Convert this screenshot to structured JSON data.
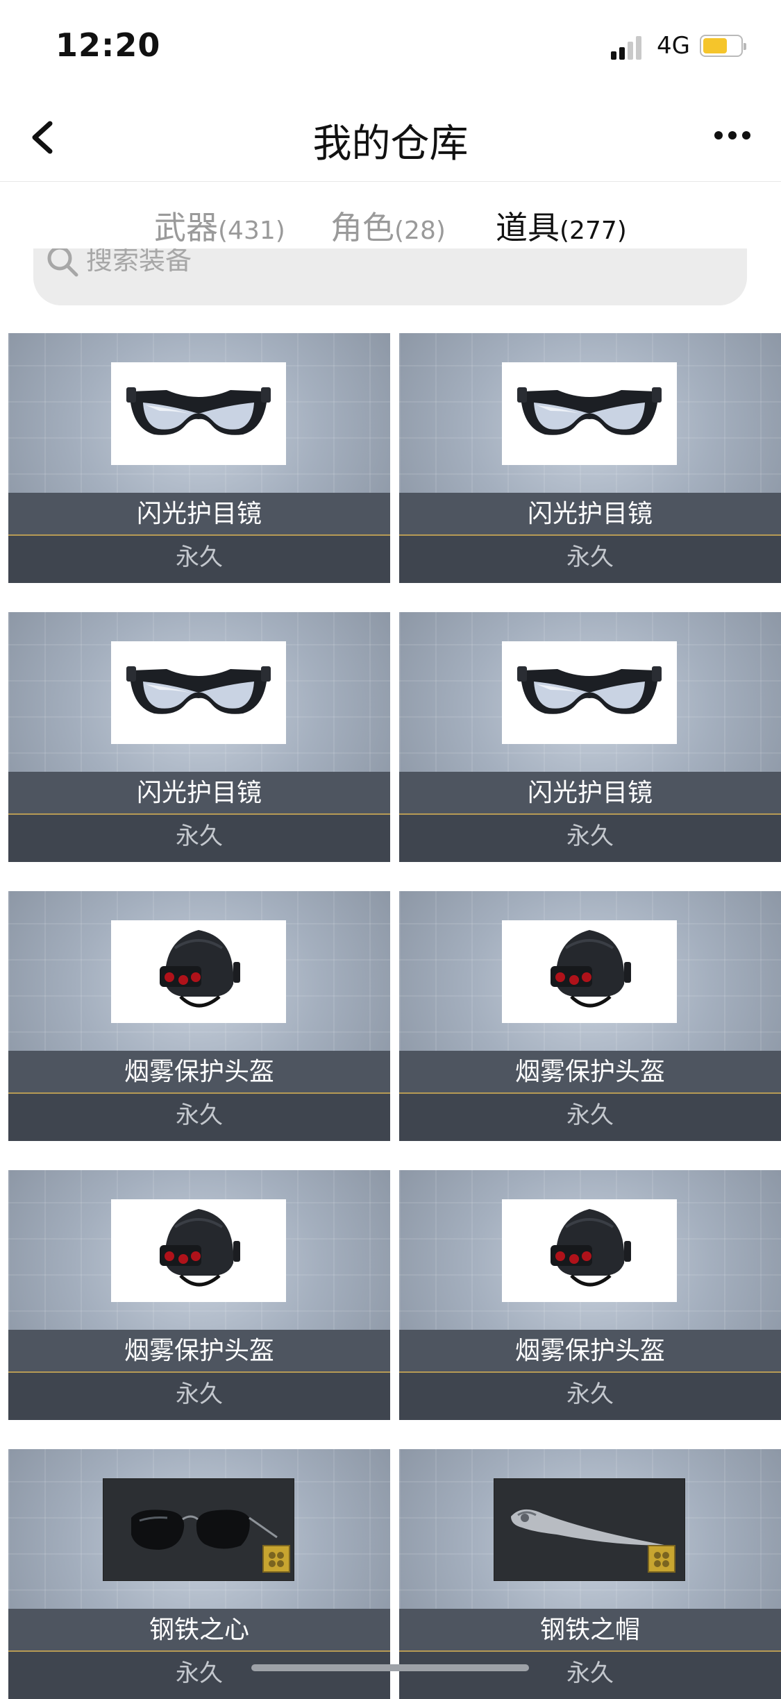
{
  "status_bar": {
    "time": "12:20",
    "network": "4G",
    "battery_color": "#f5c52b"
  },
  "nav": {
    "title": "我的仓库",
    "back_icon": "chevron-left-icon",
    "more_icon": "more-dots-icon"
  },
  "tabs": [
    {
      "label": "武器",
      "count": "(431)",
      "active": false
    },
    {
      "label": "角色",
      "count": "(28)",
      "active": false
    },
    {
      "label": "道具",
      "count": "(277)",
      "active": true
    }
  ],
  "search": {
    "placeholder": "搜索装备"
  },
  "items": [
    {
      "name": "闪光护目镜",
      "duration": "永久",
      "icon": "goggles-icon"
    },
    {
      "name": "闪光护目镜",
      "duration": "永久",
      "icon": "goggles-icon"
    },
    {
      "name": "闪光护目镜",
      "duration": "永久",
      "icon": "goggles-icon"
    },
    {
      "name": "闪光护目镜",
      "duration": "永久",
      "icon": "goggles-icon"
    },
    {
      "name": "烟雾保护头盔",
      "duration": "永久",
      "icon": "helmet-icon"
    },
    {
      "name": "烟雾保护头盔",
      "duration": "永久",
      "icon": "helmet-icon"
    },
    {
      "name": "烟雾保护头盔",
      "duration": "永久",
      "icon": "helmet-icon"
    },
    {
      "name": "烟雾保护头盔",
      "duration": "永久",
      "icon": "helmet-icon"
    },
    {
      "name": "钢铁之心",
      "duration": "永久",
      "icon": "sunglasses-icon"
    },
    {
      "name": "钢铁之帽",
      "duration": "永久",
      "icon": "steel-blade-icon"
    }
  ]
}
